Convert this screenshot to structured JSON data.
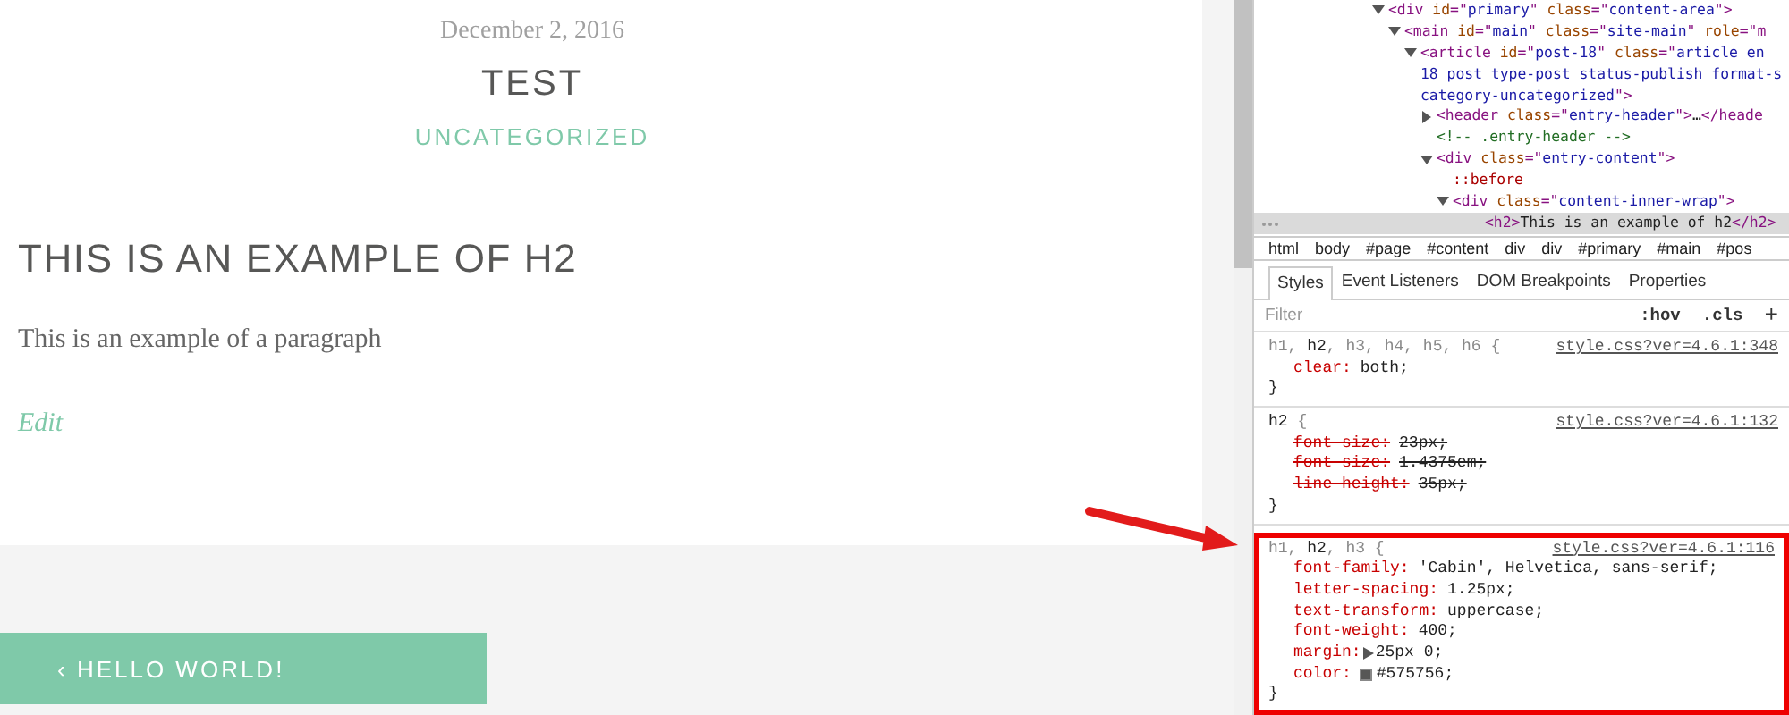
{
  "post": {
    "date": "December 2, 2016",
    "title": "TEST",
    "category": "UNCATEGORIZED",
    "heading": "THIS IS AN EXAMPLE OF H2",
    "paragraph": "This is an example of a paragraph",
    "edit_link": "Edit"
  },
  "post_navigation": {
    "previous": "‹ HELLO WORLD!"
  },
  "devtools": {
    "dom_tree": [
      {
        "expanded": true,
        "selected": false,
        "parts": [
          {
            "kind": "tag",
            "text": "<div "
          },
          {
            "kind": "attr",
            "text": "id"
          },
          {
            "kind": "tag",
            "text": "=\""
          },
          {
            "kind": "value",
            "text": "primary"
          },
          {
            "kind": "tag",
            "text": "\" "
          },
          {
            "kind": "attr",
            "text": "class"
          },
          {
            "kind": "tag",
            "text": "=\""
          },
          {
            "kind": "value",
            "text": "content-area"
          },
          {
            "kind": "tag",
            "text": "\">"
          }
        ],
        "children": [
          {
            "expanded": true,
            "selected": false,
            "parts": [
              {
                "kind": "tag",
                "text": "<main "
              },
              {
                "kind": "attr",
                "text": "id"
              },
              {
                "kind": "tag",
                "text": "=\""
              },
              {
                "kind": "value",
                "text": "main"
              },
              {
                "kind": "tag",
                "text": "\" "
              },
              {
                "kind": "attr",
                "text": "class"
              },
              {
                "kind": "tag",
                "text": "=\""
              },
              {
                "kind": "value",
                "text": "site-main"
              },
              {
                "kind": "tag",
                "text": "\" "
              },
              {
                "kind": "attr",
                "text": "role"
              },
              {
                "kind": "tag",
                "text": "=\"m"
              }
            ],
            "children": [
              {
                "expanded": true,
                "selected": false,
                "parts": [
                  {
                    "kind": "tag",
                    "text": "<article "
                  },
                  {
                    "kind": "attr",
                    "text": "id"
                  },
                  {
                    "kind": "tag",
                    "text": "=\""
                  },
                  {
                    "kind": "value",
                    "text": "post-18"
                  },
                  {
                    "kind": "tag",
                    "text": "\" "
                  },
                  {
                    "kind": "attr",
                    "text": "class"
                  },
                  {
                    "kind": "tag",
                    "text": "=\""
                  },
                  {
                    "kind": "value",
                    "text": "article en"
                  }
                ],
                "wrapped_lines": [
                  [
                    {
                      "kind": "value",
                      "text": "18 post type-post status-publish format-s"
                    }
                  ],
                  [
                    {
                      "kind": "value",
                      "text": "category-uncategorized"
                    },
                    {
                      "kind": "tag",
                      "text": "\">"
                    }
                  ]
                ],
                "children": [
                  {
                    "expanded": false,
                    "selected": false,
                    "parts": [
                      {
                        "kind": "tag",
                        "text": "<header "
                      },
                      {
                        "kind": "attr",
                        "text": "class"
                      },
                      {
                        "kind": "tag",
                        "text": "=\""
                      },
                      {
                        "kind": "value",
                        "text": "entry-header"
                      },
                      {
                        "kind": "tag",
                        "text": "\">"
                      },
                      {
                        "kind": "text",
                        "text": "…"
                      },
                      {
                        "kind": "tag",
                        "text": "</heade"
                      }
                    ]
                  },
                  {
                    "selected": false,
                    "parts": [
                      {
                        "kind": "comment",
                        "text": "<!-- .entry-header -->"
                      }
                    ]
                  },
                  {
                    "expanded": true,
                    "selected": false,
                    "parts": [
                      {
                        "kind": "tag",
                        "text": "<div "
                      },
                      {
                        "kind": "attr",
                        "text": "class"
                      },
                      {
                        "kind": "tag",
                        "text": "=\""
                      },
                      {
                        "kind": "value",
                        "text": "entry-content"
                      },
                      {
                        "kind": "tag",
                        "text": "\">"
                      }
                    ],
                    "children": [
                      {
                        "selected": false,
                        "parts": [
                          {
                            "kind": "pseudo",
                            "text": "::before"
                          }
                        ]
                      },
                      {
                        "expanded": true,
                        "selected": false,
                        "parts": [
                          {
                            "kind": "tag",
                            "text": "<div "
                          },
                          {
                            "kind": "attr",
                            "text": "class"
                          },
                          {
                            "kind": "tag",
                            "text": "=\""
                          },
                          {
                            "kind": "value",
                            "text": "content-inner-wrap"
                          },
                          {
                            "kind": "tag",
                            "text": "\">"
                          }
                        ],
                        "children": [
                          {
                            "selected": true,
                            "parts": [
                              {
                                "kind": "tag",
                                "text": "<h2>"
                              },
                              {
                                "kind": "text",
                                "text": "This is an example of h2"
                              },
                              {
                                "kind": "tag",
                                "text": "</h2>"
                              }
                            ]
                          }
                        ]
                      }
                    ]
                  }
                ]
              }
            ]
          }
        ]
      }
    ],
    "breadcrumbs": [
      "html",
      "body",
      "#page",
      "#content",
      "div",
      "div",
      "#primary",
      "#main",
      "#pos"
    ],
    "tabs": [
      {
        "label": "Styles",
        "selected": true
      },
      {
        "label": "Event Listeners",
        "selected": false
      },
      {
        "label": "DOM Breakpoints",
        "selected": false
      },
      {
        "label": "Properties",
        "selected": false
      }
    ],
    "filter": {
      "placeholder": "Filter",
      "hov": ":hov",
      "cls": ".cls",
      "add": "+"
    },
    "rules": [
      {
        "highlighted": false,
        "selector": [
          {
            "text": "h1, ",
            "matched": false
          },
          {
            "text": "h2",
            "matched": true
          },
          {
            "text": ", h3, h4, h5, h6",
            "matched": false
          }
        ],
        "open": " {",
        "source": "style.css?ver=4.6.1:348",
        "properties": [
          {
            "name": "clear:",
            "value": "both;",
            "overridden": false
          }
        ],
        "close": "}"
      },
      {
        "highlighted": false,
        "selector": [
          {
            "text": "h2",
            "matched": true
          }
        ],
        "open": " {",
        "source": "style.css?ver=4.6.1:132",
        "properties": [
          {
            "name": "font-size:",
            "value": "23px;",
            "overridden": true
          },
          {
            "name": "font-size:",
            "value": "1.4375em;",
            "overridden": true
          },
          {
            "name": "line-height:",
            "value": "35px;",
            "overridden": true
          }
        ],
        "close": "}"
      },
      {
        "highlighted": true,
        "selector": [
          {
            "text": "h1, ",
            "matched": false
          },
          {
            "text": "h2",
            "matched": true
          },
          {
            "text": ", h3",
            "matched": false
          }
        ],
        "open": " {",
        "source": "style.css?ver=4.6.1:116",
        "properties": [
          {
            "name": "font-family:",
            "value": "'Cabin', Helvetica, sans-serif;",
            "overridden": false
          },
          {
            "name": "letter-spacing:",
            "value": "1.25px;",
            "overridden": false
          },
          {
            "name": "text-transform:",
            "value": "uppercase;",
            "overridden": false
          },
          {
            "name": "font-weight:",
            "value": "400;",
            "overridden": false
          },
          {
            "name": "margin:",
            "value": "25px 0;",
            "overridden": false,
            "expandable": true
          },
          {
            "name": "color:",
            "value": "#575756;",
            "overridden": false,
            "color": "#575756"
          }
        ],
        "close": "}"
      }
    ]
  }
}
